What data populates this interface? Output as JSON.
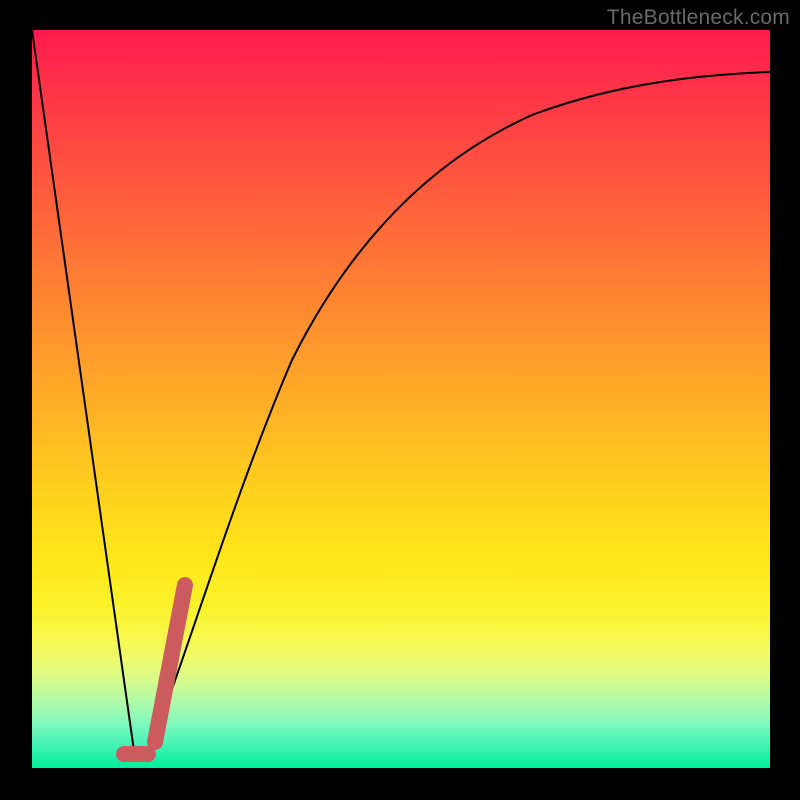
{
  "watermark": "TheBottleneck.com",
  "colors": {
    "accent": "#cc5b5e",
    "curve": "#000000",
    "frame": "#000000"
  },
  "chart_data": {
    "type": "line",
    "title": "",
    "xlabel": "",
    "ylabel": "",
    "xlim": [
      0,
      100
    ],
    "ylim": [
      0,
      100
    ],
    "note": "Y expressed as height above bottom (0 = bottom of plot, 100 = top). Curve is V-shaped: steep linear drop then saturating rise.",
    "series": [
      {
        "name": "bottleneck-curve",
        "x": [
          0,
          5,
          10,
          12,
          14,
          16,
          18,
          22,
          26,
          30,
          35,
          40,
          50,
          60,
          70,
          80,
          90,
          100
        ],
        "values": [
          100,
          60,
          20,
          4,
          0,
          8,
          18,
          38,
          52,
          62,
          71,
          77,
          84,
          88,
          90.5,
          92,
          93,
          94
        ]
      }
    ],
    "accent_segments": [
      {
        "name": "near-minimum-right-rise",
        "x": [
          16,
          20
        ],
        "values": [
          8,
          28
        ]
      },
      {
        "name": "minimum-flat",
        "x": [
          12,
          15
        ],
        "values": [
          1.5,
          1.5
        ]
      }
    ],
    "gradient_stops": [
      {
        "pos": 0.0,
        "hex": "#ff1a4d"
      },
      {
        "pos": 0.5,
        "hex": "#ffb824"
      },
      {
        "pos": 0.8,
        "hex": "#f8f84a"
      },
      {
        "pos": 1.0,
        "hex": "#00ee9c"
      }
    ]
  }
}
